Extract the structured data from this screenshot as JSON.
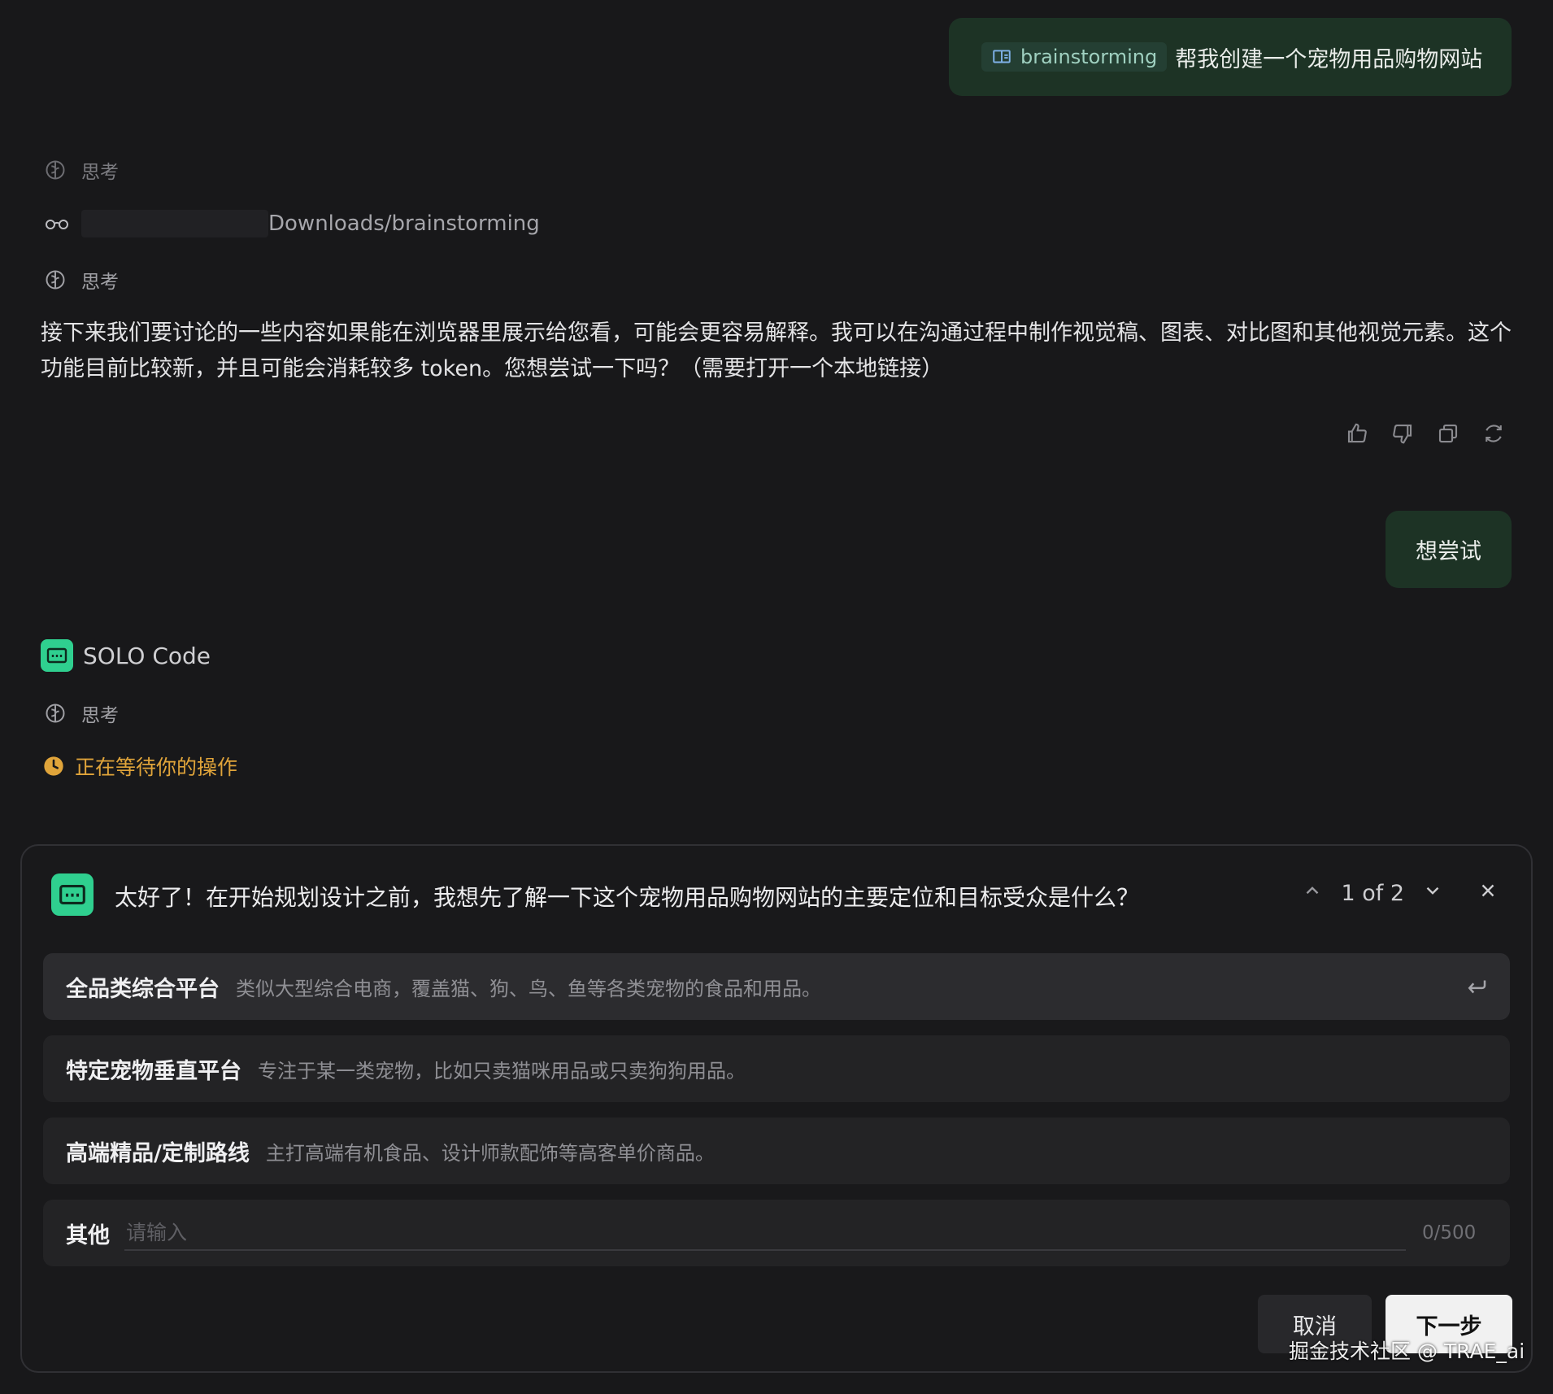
{
  "user_message_1": {
    "skill": "brainstorming",
    "text": "帮我创建一个宠物用品购物网站"
  },
  "thought_label": "思考",
  "path_text": "Downloads/brainstorming",
  "answer_text": "接下来我们要讨论的一些内容如果能在浏览器里展示给您看，可能会更容易解释。我可以在沟通过程中制作视觉稿、图表、对比图和其他视觉元素。这个功能目前比较新，并且可能会消耗较多 token。您想尝试一下吗？（需要打开一个本地链接）",
  "user_message_2": "想尝试",
  "agent_name": "SOLO Code",
  "waiting_text": "正在等待你的操作",
  "question": {
    "text": "太好了！在开始规划设计之前，我想先了解一下这个宠物用品购物网站的主要定位和目标受众是什么？",
    "pager": "1 of 2",
    "options": [
      {
        "title": "全品类综合平台",
        "desc": "类似大型综合电商，覆盖猫、狗、鸟、鱼等各类宠物的食品和用品。"
      },
      {
        "title": "特定宠物垂直平台",
        "desc": "专注于某一类宠物，比如只卖猫咪用品或只卖狗狗用品。"
      },
      {
        "title": "高端精品/定制路线",
        "desc": "主打高端有机食品、设计师款配饰等高客单价商品。"
      }
    ],
    "other_label": "其他",
    "other_placeholder": "请输入",
    "other_value": "",
    "counter": "0/500",
    "cancel_label": "取消",
    "next_label": "下一步"
  },
  "watermark": "掘金技术社区 @ TRAE_ai",
  "colors": {
    "accent_green": "#2fcf8f",
    "bubble": "#1d3325",
    "waiting": "#e0a43a"
  }
}
